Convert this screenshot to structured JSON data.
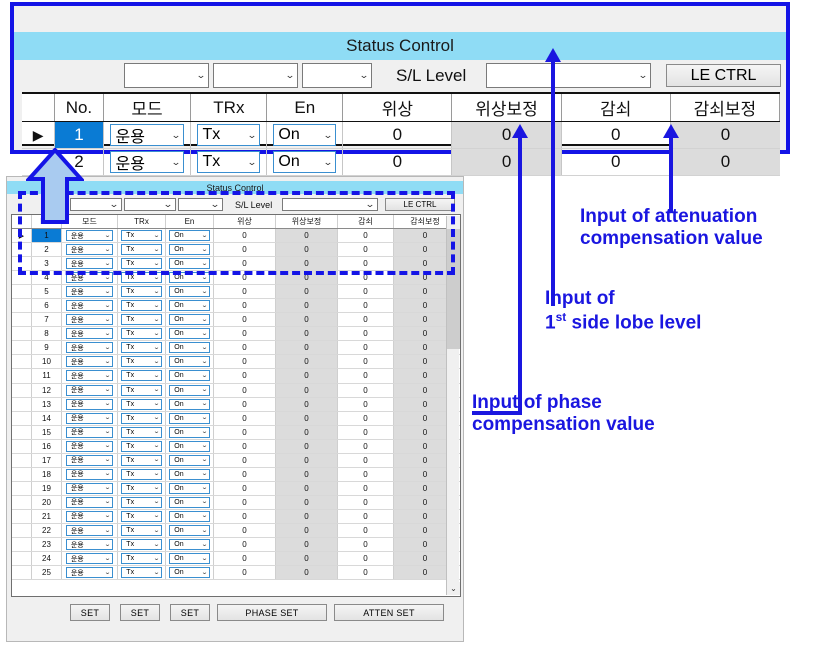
{
  "window": {
    "title": "Status Control",
    "sl_level_label": "S/L Level",
    "le_ctrl_label": "LE CTRL",
    "combo_placeholder": ""
  },
  "table": {
    "columns": [
      "",
      "No.",
      "모드",
      "TRx",
      "En",
      "위상",
      "위상보정",
      "감쇠",
      "감쇠보정"
    ],
    "row_marker": "▶",
    "defaults": {
      "mode": "운용",
      "trx": "Tx",
      "en": "On",
      "phase": "0",
      "phase_comp": "0",
      "atten": "0",
      "atten_comp": "0"
    },
    "row_numbers_zoom": [
      "1",
      "2"
    ],
    "row_numbers_main": [
      "1",
      "2",
      "3",
      "4",
      "5",
      "6",
      "7",
      "8",
      "9",
      "10",
      "11",
      "12",
      "13",
      "14",
      "15",
      "16",
      "17",
      "18",
      "19",
      "20",
      "21",
      "22",
      "23",
      "24",
      "25"
    ]
  },
  "buttons": {
    "set1": "SET",
    "set2": "SET",
    "set3": "SET",
    "phase_set": "PHASE SET",
    "atten_set": "ATTEN SET"
  },
  "scrollbar": {
    "up_glyph": "⌃",
    "down_glyph": "⌄"
  },
  "annotations": {
    "attenuation": "Input of attenuation compensation value",
    "attenuation_l1": "Input of attenuation",
    "attenuation_l2": "compensation value",
    "side_lobe_l1": "Input of",
    "side_lobe_l2_pre": "1",
    "side_lobe_l2_sup": "st",
    "side_lobe_l2_post": " side lobe level",
    "phase_l1": "Input of phase",
    "phase_l2": "compensation value"
  },
  "colors": {
    "titlebar": "#8fdcf5",
    "callout_border": "#1414e6",
    "annotation_text": "#1a16e0",
    "selection": "#0a7bd4",
    "readonly_cell": "#dcdcdc",
    "combo_border": "#3a8fd0"
  }
}
